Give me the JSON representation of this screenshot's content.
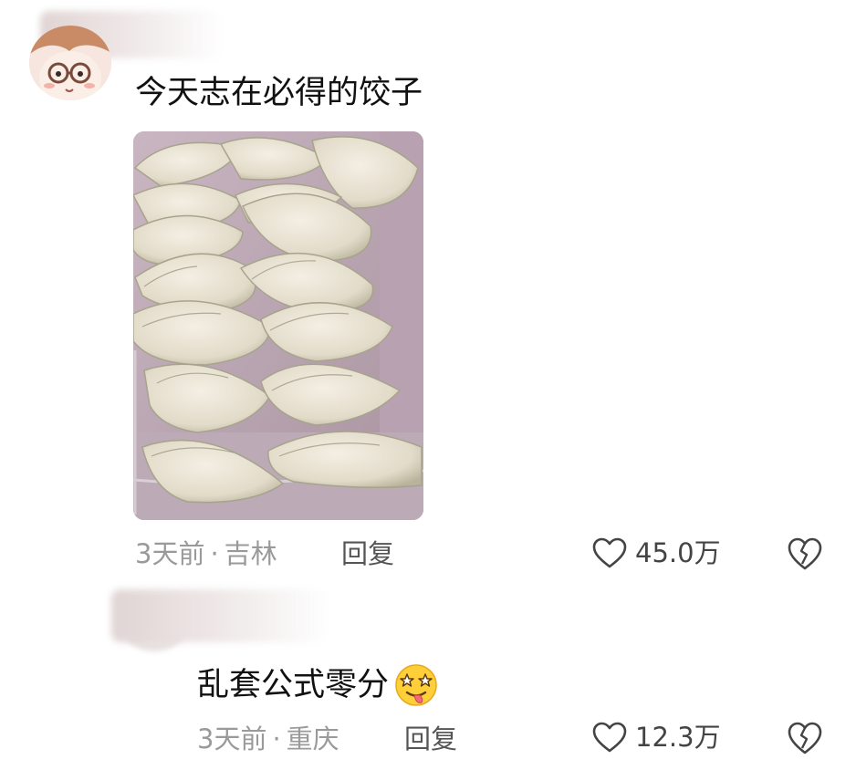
{
  "comments": [
    {
      "text": "今天志在必得的饺子",
      "time": "3天前",
      "separator": "·",
      "location": "吉林",
      "reply_label": "回复",
      "likes": "45.0万",
      "has_image": true
    },
    {
      "text": "乱套公式零分",
      "time": "3天前",
      "separator": "·",
      "location": "重庆",
      "reply_label": "回复",
      "likes": "12.3万",
      "emoji": "drooling-face-emoji"
    }
  ],
  "icons": {
    "like": "heart-outline-icon",
    "dislike": "broken-heart-icon"
  },
  "colors": {
    "text": "#111111",
    "meta": "#9a9a9a",
    "icon": "#444444"
  }
}
